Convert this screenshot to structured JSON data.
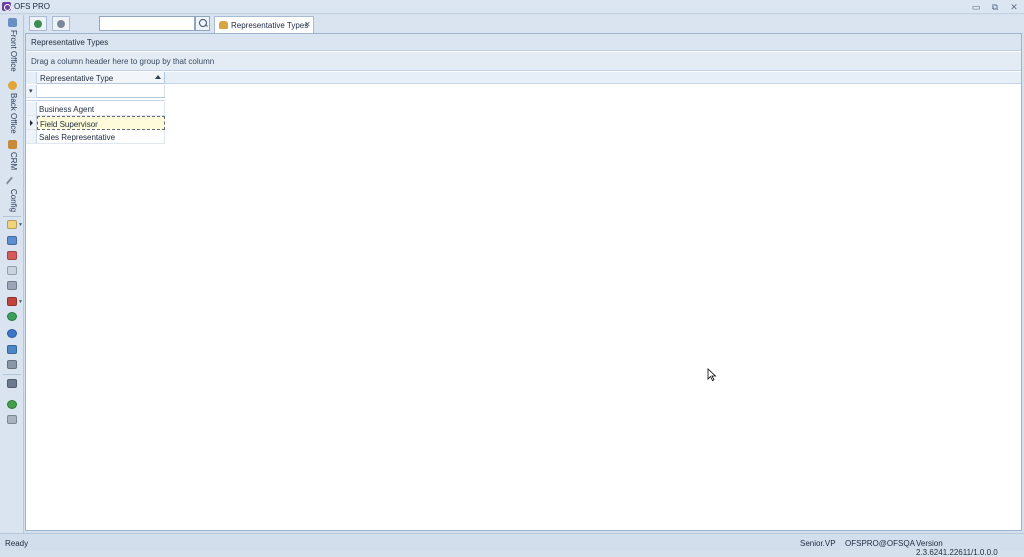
{
  "window": {
    "title": "OFS PRO",
    "min_label": "▭",
    "restore_label": "⧉",
    "close_label": "✕"
  },
  "left_nav": {
    "tabs": [
      {
        "label": "Front Office",
        "icon": "front-office-icon",
        "color": "#6a8fc4"
      },
      {
        "label": "Back Office",
        "icon": "back-office-icon",
        "color": "#e0a43a"
      },
      {
        "label": "CRM",
        "icon": "crm-icon",
        "color": "#c88a3c"
      },
      {
        "label": "Config",
        "icon": "wrench-icon",
        "color": "#7b8797"
      }
    ],
    "tools": [
      {
        "icon": "new-document-icon",
        "color": "#f1d37a"
      },
      {
        "icon": "grid-settings-icon",
        "color": "#5d8fd0"
      },
      {
        "icon": "grid-delete-icon",
        "color": "#d55a5a"
      },
      {
        "icon": "copy-icon",
        "color": "#c9d3df"
      },
      {
        "icon": "export-icon",
        "color": "#9aa6b5"
      },
      {
        "icon": "report-icon",
        "color": "#c0443b"
      },
      {
        "icon": "refresh-icon",
        "color": "#3aa05a"
      },
      {
        "icon": "globe-icon",
        "color": "#3b77c8"
      },
      {
        "icon": "layers-icon",
        "color": "#4d86c7"
      },
      {
        "icon": "calculator-icon",
        "color": "#8a97a8"
      },
      {
        "icon": "printer-icon",
        "color": "#6d7a8c"
      },
      {
        "icon": "help-icon",
        "color": "#43a04a"
      },
      {
        "icon": "mail-icon",
        "color": "#a8b3c2"
      }
    ]
  },
  "toolbar": {
    "search_value": "",
    "search_placeholder": "",
    "tab_label": "Representative Types",
    "tab_close": "✕"
  },
  "panel": {
    "title": "Representative Types",
    "group_hint": "Drag a column header here to group by that column"
  },
  "grid": {
    "column_header": "Representative Type",
    "filter_glyph": "▾",
    "rows": [
      {
        "value": "Business Agent",
        "focused": false
      },
      {
        "value": "Field Supervisor",
        "focused": true
      },
      {
        "value": "Sales Representative",
        "focused": false
      }
    ]
  },
  "status": {
    "left": "Ready",
    "user": "Senior.VP",
    "connection": "OFSPRO@OFSQA",
    "version": "Version 2.3.6241.22611/1.0.0.0"
  }
}
